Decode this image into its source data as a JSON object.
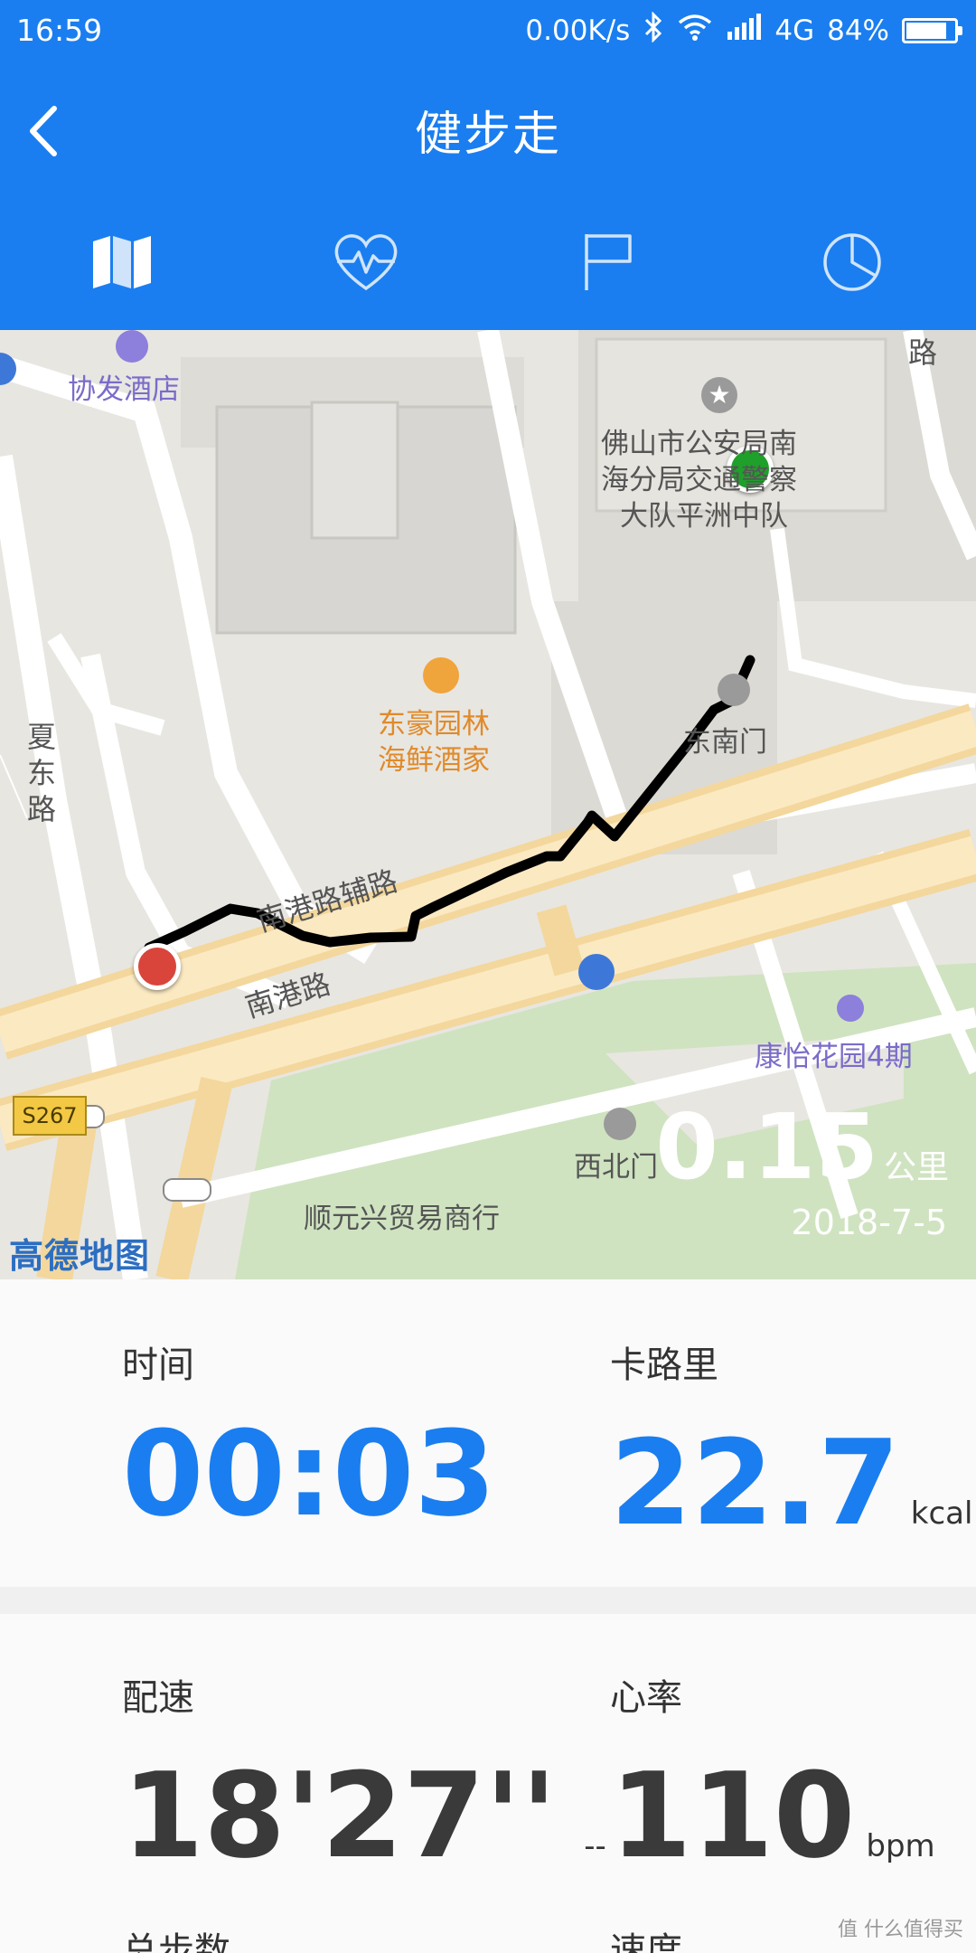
{
  "status_bar": {
    "time": "16:59",
    "network_speed": "0.00K/s",
    "network_type": "4G",
    "battery_percent": "84%",
    "battery_level": 0.84
  },
  "header": {
    "title": "健步走",
    "back_icon": "chevron-left-icon"
  },
  "tabs": [
    {
      "icon": "map-icon",
      "active": true
    },
    {
      "icon": "heart-pulse-icon",
      "active": false
    },
    {
      "icon": "flag-icon",
      "active": false
    },
    {
      "icon": "pie-chart-icon",
      "active": false
    }
  ],
  "map": {
    "labels": {
      "hotel": "协发酒店",
      "police_1": "佛山市公安局南",
      "police_2": "海分局交通警察",
      "police_3": "大队平洲中队",
      "restaurant_1": "东豪园林",
      "restaurant_2": "海鲜酒家",
      "east_gate": "东南门",
      "road_xiadong": "夏东路",
      "road_nangang_aux": "南港路辅路",
      "road_nangang": "南港路",
      "garden": "康怡花园4期",
      "northwest_gate": "西北门",
      "trade": "顺元兴贸易商行",
      "highway": "S267",
      "road_top_right": "路"
    },
    "logo": "高德地图",
    "distance": "0.15",
    "distance_unit": "公里",
    "date": "2018-7-5",
    "colors": {
      "start_marker": "#1fa02a",
      "end_marker": "#d9453b",
      "route": "#000000",
      "park": "#cfe3c0"
    }
  },
  "stats": {
    "time": {
      "label": "时间",
      "value": "00:03"
    },
    "calories": {
      "label": "卡路里",
      "value": "22.7",
      "unit": "kcal"
    },
    "pace": {
      "label": "配速",
      "value": "18'27''",
      "unit": "--"
    },
    "heart_rate": {
      "label": "心率",
      "value": "110",
      "unit": "bpm"
    },
    "steps": {
      "label": "总步数"
    },
    "speed": {
      "label": "速度"
    }
  },
  "watermark": "值 什么值得买",
  "colors": {
    "accent": "#1a7ef0",
    "value_blue": "#1a7ef0",
    "value_dark": "#3a3a3a"
  }
}
